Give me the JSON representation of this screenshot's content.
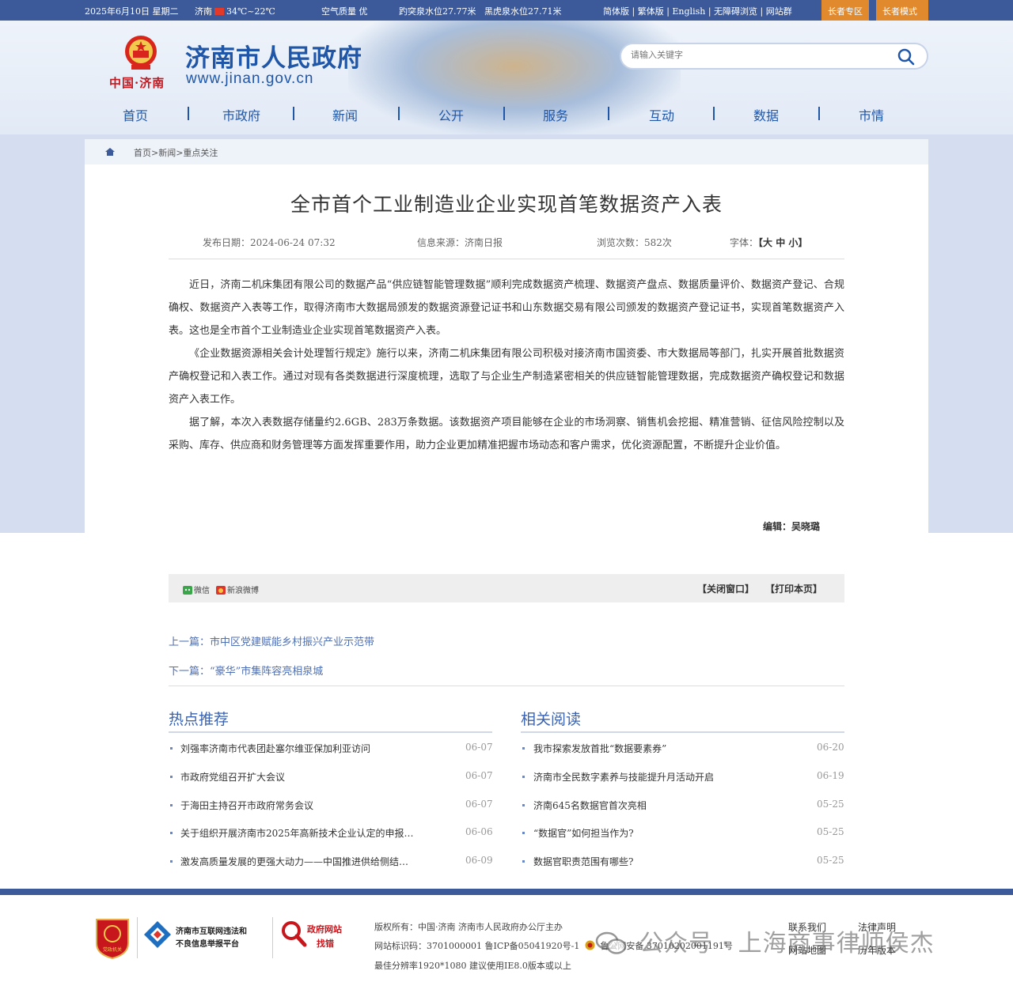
{
  "topbar": {
    "date": "2025年6月10日 星期二",
    "weather_city": "济南",
    "weather_temp": "34℃~22℃",
    "air_quality": "空气质量 优",
    "spring1": "趵突泉水位27.77米",
    "spring2": "黑虎泉水位27.71米",
    "links": "简体版 | 繁体版 | English | 无障碍浏览 | 网站群",
    "elder_zone": "长者专区",
    "elder_mode": "长者模式"
  },
  "header": {
    "logo_cn": "中国·济南",
    "site_name": "济南市人民政府",
    "site_url": "www.jinan.gov.cn",
    "search_placeholder": "请输入关键字"
  },
  "nav": [
    "首页",
    "市政府",
    "新闻",
    "公开",
    "服务",
    "互动",
    "数据",
    "市情"
  ],
  "breadcrumb": "首页>新闻>重点关注",
  "article": {
    "title": "全市首个工业制造业企业实现首笔数据资产入表",
    "publish_date": "发布日期：2024-06-24 07:32",
    "source": "信息来源：济南日报",
    "views": "浏览次数：582次",
    "font_label": "字体：",
    "font_sizes": "【大 中 小】",
    "paragraphs": [
      "近日，济南二机床集团有限公司的数据产品“供应链智能管理数据”顺利完成数据资产梳理、数据资产盘点、数据质量评价、数据资产登记、合规确权、数据资产入表等工作，取得济南市大数据局颁发的数据资源登记证书和山东数据交易有限公司颁发的数据资产登记证书，实现首笔数据资产入表。这也是全市首个工业制造业企业实现首笔数据资产入表。",
      "《企业数据资源相关会计处理暂行规定》施行以来，济南二机床集团有限公司积极对接济南市国资委、市大数据局等部门，扎实开展首批数据资产确权登记和入表工作。通过对现有各类数据进行深度梳理，选取了与企业生产制造紧密相关的供应链智能管理数据，完成数据资产确权登记和数据资产入表工作。",
      "据了解，本次入表数据存储量约2.6GB、283万条数据。该数据资产项目能够在企业的市场洞察、销售机会挖掘、精准营销、征信风险控制以及采购、库存、供应商和财务管理等方面发挥重要作用，助力企业更加精准把握市场动态和客户需求，优化资源配置，不断提升企业价值。"
    ],
    "editor": "编辑：吴晓璐"
  },
  "share": {
    "wechat": "微信",
    "weibo": "新浪微博",
    "close": "【关闭窗口】",
    "print": "【打印本页】"
  },
  "prev": "上一篇：市中区党建赋能乡村振兴产业示范带",
  "next": "下一篇：“豪华”市集阵容亮相泉城",
  "hot": {
    "title": "热点推荐",
    "items": [
      {
        "text": "刘强率济南市代表团赴塞尔维亚保加利亚访问",
        "date": "06-07"
      },
      {
        "text": "市政府党组召开扩大会议",
        "date": "06-07"
      },
      {
        "text": "于海田主持召开市政府常务会议",
        "date": "06-07"
      },
      {
        "text": "关于组织开展济南市2025年高新技术企业认定的申报…",
        "date": "06-06"
      },
      {
        "text": "激发高质量发展的更强大动力——中国推进供给侧结…",
        "date": "06-09"
      }
    ]
  },
  "related": {
    "title": "相关阅读",
    "items": [
      {
        "text": "我市探索发放首批“数据要素券”",
        "date": "06-20"
      },
      {
        "text": "济南市全民数字素养与技能提升月活动开启",
        "date": "06-19"
      },
      {
        "text": "济南645名数据官首次亮相",
        "date": "05-25"
      },
      {
        "text": "“数据官”如何担当作为?",
        "date": "05-25"
      },
      {
        "text": "数据官职责范围有哪些?",
        "date": "05-25"
      }
    ]
  },
  "footer": {
    "badge1": "党政机关",
    "report_line1": "济南市互联网违法和",
    "report_line2": "不良信息举报平台",
    "error_line1": "政府网站",
    "error_line2": "找错",
    "copyright": "版权所有：中国·济南 济南市人民政府办公厅主办",
    "icp": "网站标识码：3701000001 鲁ICP备05041920号-1",
    "police": "鲁公网安备 37010202001191号",
    "resolution": "最佳分辨率1920*1080 建议使用IE8.0版本或以上",
    "contact": "联系我们",
    "legal": "法律声明",
    "sitemap": "网站地图",
    "history": "历年版本",
    "watermark": "公众号 · 上海商事律师侯杰"
  },
  "colors": {
    "primary": "#3c5a9a",
    "accent_orange": "#e1892d",
    "title_blue": "#1f56a8",
    "link_blue": "#4e6fb3",
    "brand_red": "#c8161d"
  }
}
